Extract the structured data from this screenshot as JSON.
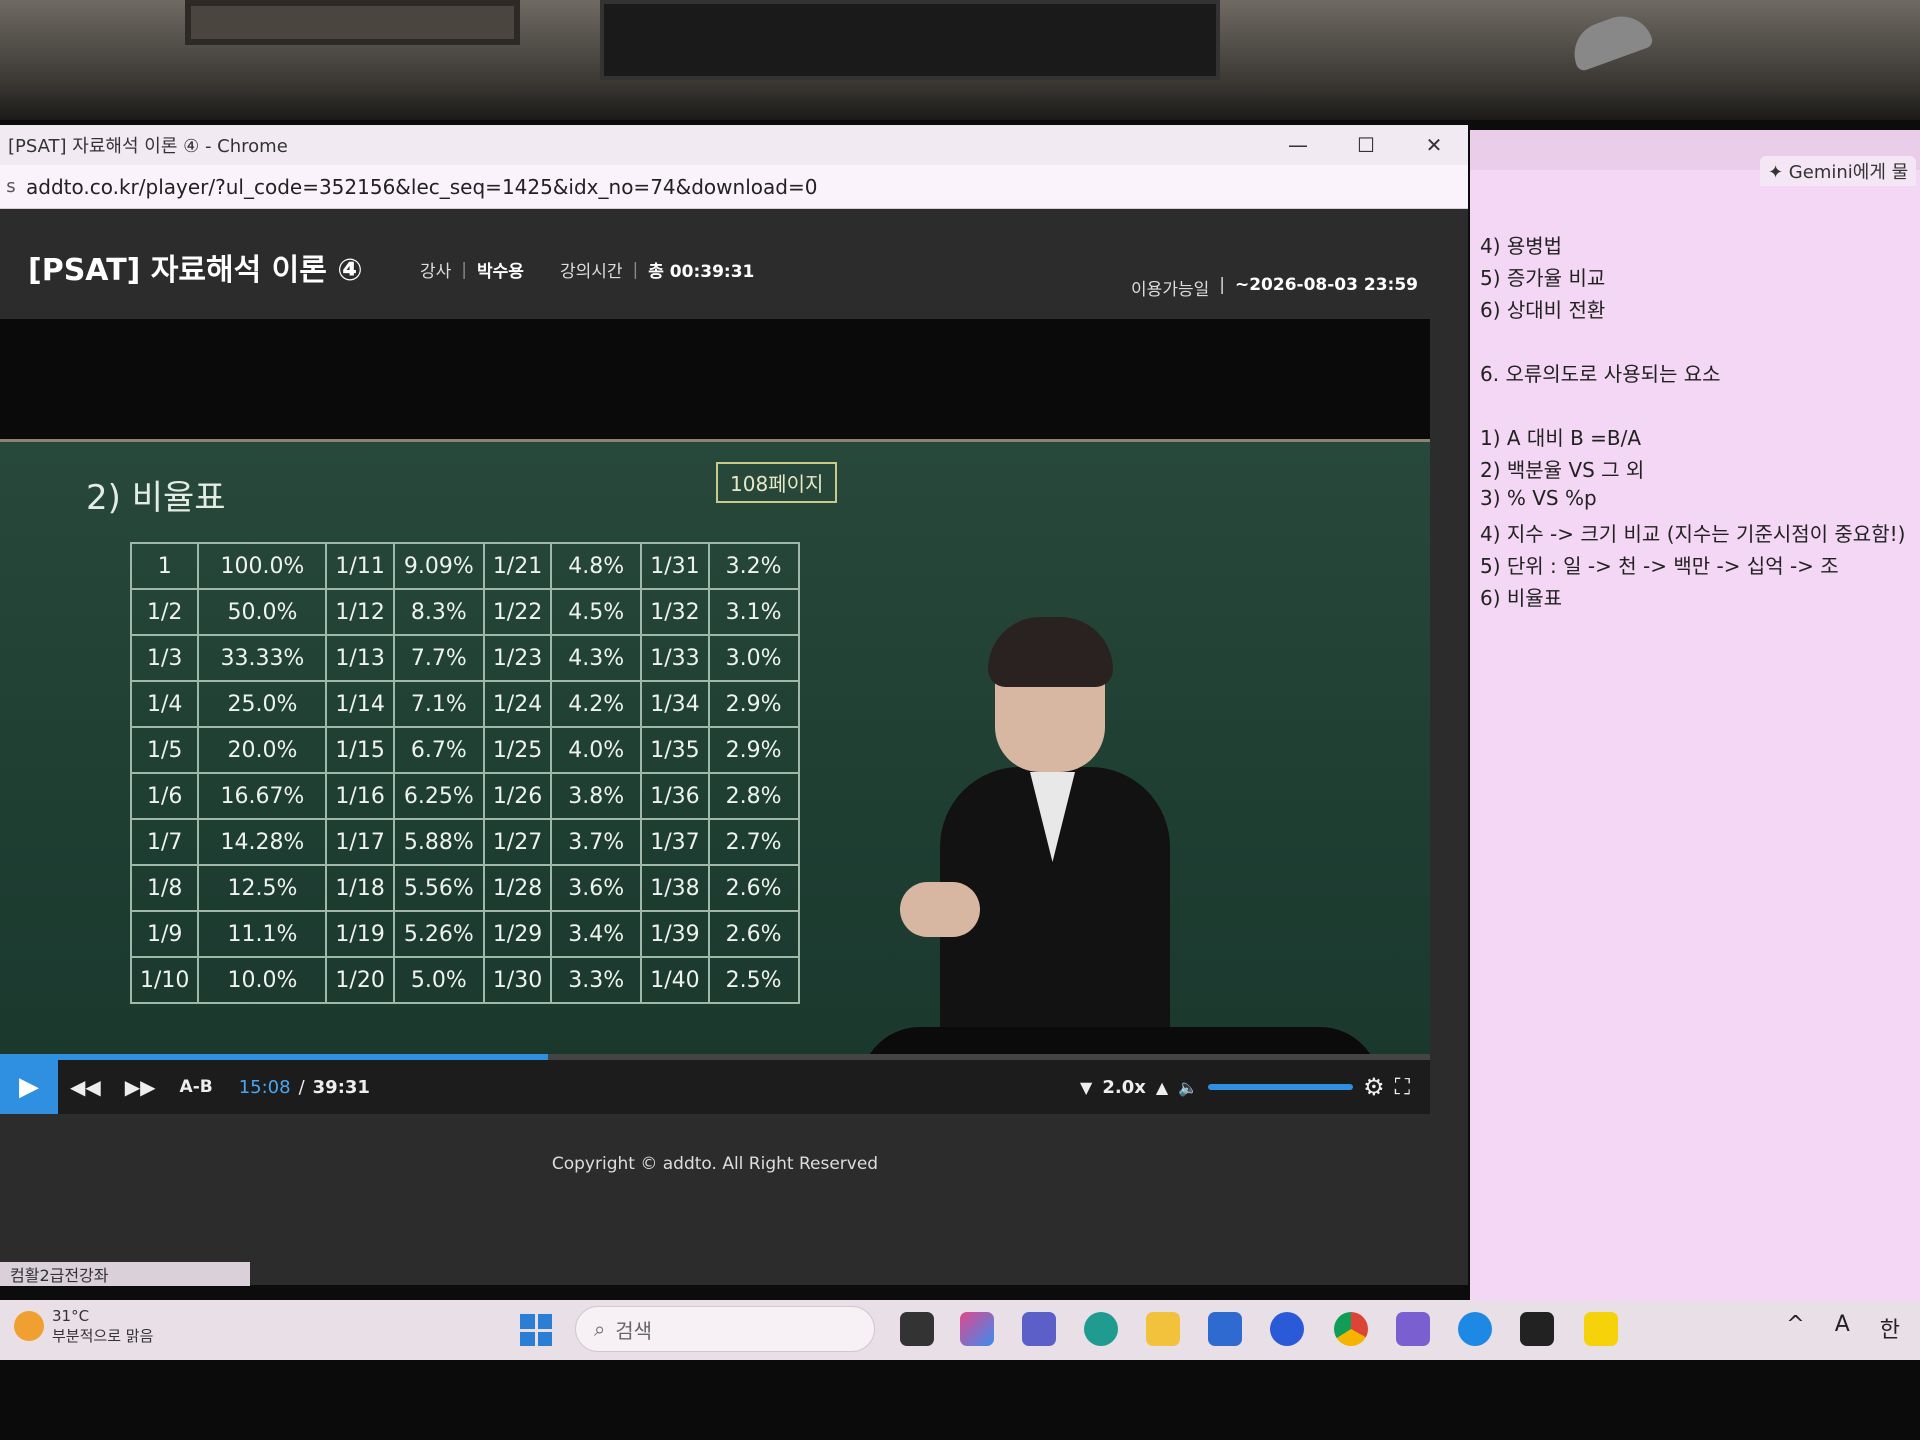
{
  "window": {
    "title": "[PSAT] 자료해석 이론 ④ - Chrome",
    "min": "—",
    "max": "☐",
    "close": "✕",
    "url": "addto.co.kr/player/?ul_code=352156&lec_seq=1425&idx_no=74&download=0",
    "security_icon": "s"
  },
  "player": {
    "lecture_title": "[PSAT] 자료해석 이론 ④",
    "instructor_label": "강사",
    "instructor": "박수용",
    "duration_label": "강의시간",
    "duration": "총 00:39:31",
    "avail_label": "이용가능일",
    "avail_value": "~2026-08-03 23:59",
    "sep": "|"
  },
  "board": {
    "heading": "2) 비율표",
    "page_tag": "108페이지",
    "rows": [
      [
        "1",
        "100.0%",
        "1/11",
        "9.09%",
        "1/21",
        "4.8%",
        "1/31",
        "3.2%"
      ],
      [
        "1/2",
        "50.0%",
        "1/12",
        "8.3%",
        "1/22",
        "4.5%",
        "1/32",
        "3.1%"
      ],
      [
        "1/3",
        "33.33%",
        "1/13",
        "7.7%",
        "1/23",
        "4.3%",
        "1/33",
        "3.0%"
      ],
      [
        "1/4",
        "25.0%",
        "1/14",
        "7.1%",
        "1/24",
        "4.2%",
        "1/34",
        "2.9%"
      ],
      [
        "1/5",
        "20.0%",
        "1/15",
        "6.7%",
        "1/25",
        "4.0%",
        "1/35",
        "2.9%"
      ],
      [
        "1/6",
        "16.67%",
        "1/16",
        "6.25%",
        "1/26",
        "3.8%",
        "1/36",
        "2.8%"
      ],
      [
        "1/7",
        "14.28%",
        "1/17",
        "5.88%",
        "1/27",
        "3.7%",
        "1/37",
        "2.7%"
      ],
      [
        "1/8",
        "12.5%",
        "1/18",
        "5.56%",
        "1/28",
        "3.6%",
        "1/38",
        "2.6%"
      ],
      [
        "1/9",
        "11.1%",
        "1/19",
        "5.26%",
        "1/29",
        "3.4%",
        "1/39",
        "2.6%"
      ],
      [
        "1/10",
        "10.0%",
        "1/20",
        "5.0%",
        "1/30",
        "3.3%",
        "1/40",
        "2.5%"
      ]
    ]
  },
  "controls": {
    "play_icon": "▶",
    "rewind_icon": "◀◀",
    "forward_icon": "▶▶",
    "ab_label": "A-B",
    "current_time": "15:08",
    "slash": "/",
    "total_time": "39:31",
    "speed_down_icon": "▼",
    "speed": "2.0x",
    "speed_up_icon": "▲",
    "volume_icon": "🔈",
    "settings_icon": "⚙",
    "fullscreen_icon": "⛶",
    "progress_fraction": 0.383,
    "accent": "#2f8fe0"
  },
  "footer": {
    "copyright": "Copyright © addto. All Right Reserved",
    "tab_label": "컴활2급전강좌"
  },
  "side": {
    "gemini_tab": "✦ Gemini에게 물",
    "notes": [
      "4) 용병법",
      "5) 증가율 비교",
      "6) 상대비 전환",
      "",
      "6. 오류의도로 사용되는 요소",
      "",
      "1) A 대비 B =B/A",
      "2) 백분율 VS 그 외",
      "3) % VS %p",
      "4) 지수 -> 크기 비교 (지수는 기준시점이 중요함!)",
      "5) 단위 : 일 -> 천 -> 백만 -> 십억 -> 조",
      "6) 비율표"
    ]
  },
  "taskbar": {
    "temp": "31°C",
    "weather": "부분적으로 맑음",
    "search_placeholder": "검색",
    "search_icon": "⌕",
    "tray_chevron": "^",
    "tray_font": "A",
    "tray_ime": "한"
  }
}
